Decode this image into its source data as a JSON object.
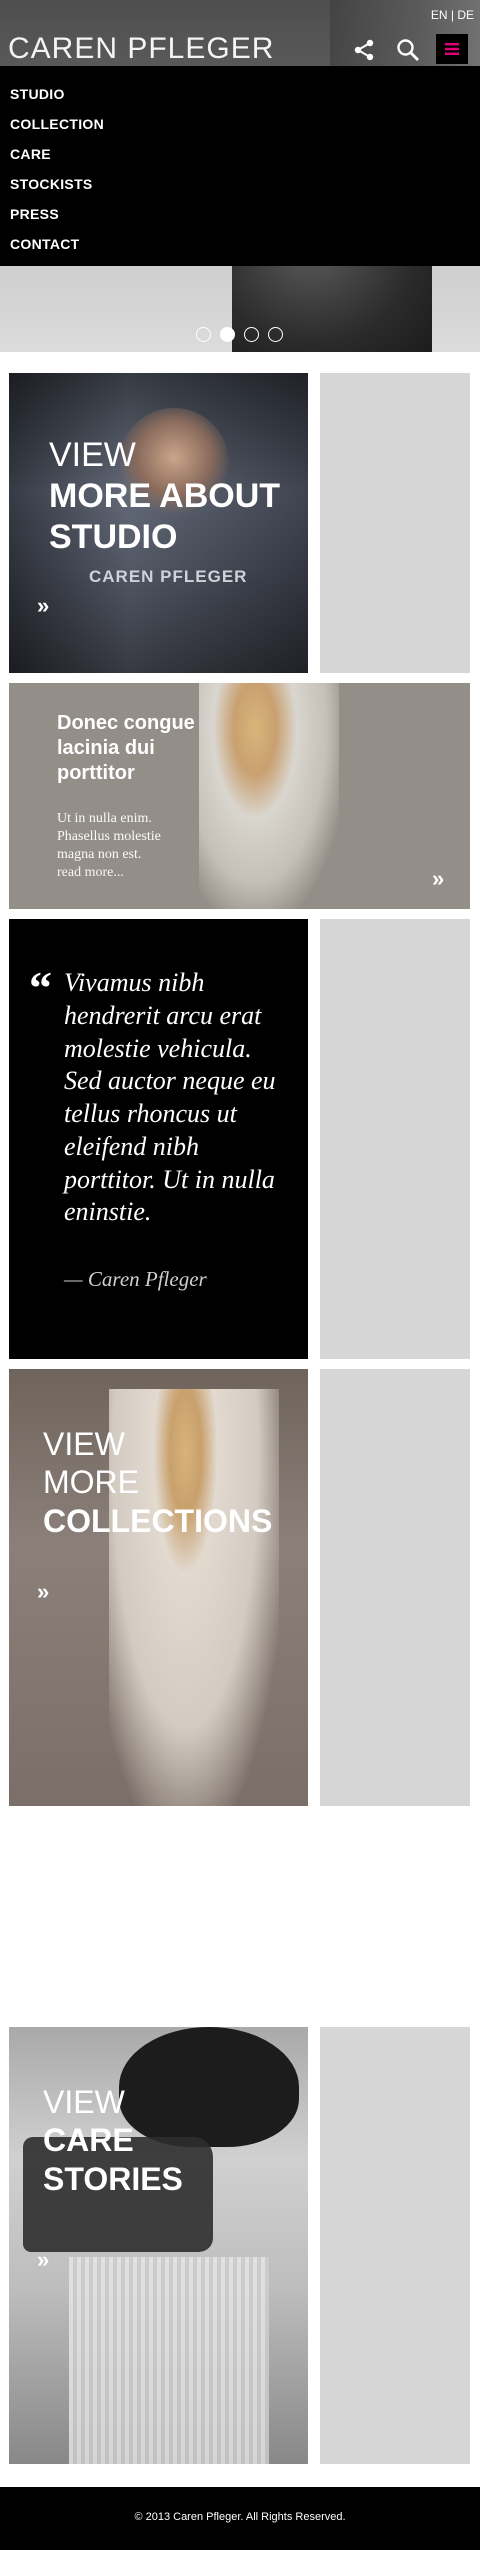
{
  "header": {
    "brand": "CAREN PFLEGER",
    "lang_en": "EN",
    "lang_sep": "|",
    "lang_de": "DE",
    "icons": [
      "share-icon",
      "search-icon",
      "hamburger-icon"
    ],
    "accent_color": "#e2007a"
  },
  "menu": {
    "items": [
      {
        "label": "STUDIO"
      },
      {
        "label": "COLLECTION"
      },
      {
        "label": "CARE"
      },
      {
        "label": "STOCKISTS"
      },
      {
        "label": "PRESS"
      },
      {
        "label": "CONTACT"
      }
    ]
  },
  "slider": {
    "total": 4,
    "active": 2
  },
  "tiles": {
    "studio": {
      "line1": "VIEW",
      "line2": "MORE ABOUT",
      "line3": "STUDIO",
      "sign": "CAREN PFLEGER",
      "chevron": "»"
    },
    "feature": {
      "title": "Donec congue lacinia dui porttitor",
      "body": "Ut in nulla enim. Phasellus molestie magna non est.",
      "more": "read more...",
      "chevron": "»"
    },
    "quote": {
      "mark": "“",
      "text": "Vivamus nibh hendrerit arcu erat molestie vehicula. Sed auctor neque eu tellus rhoncus ut eleifend nibh porttitor. Ut in nulla eninstie.",
      "author": "— Caren Pfleger"
    },
    "collections": {
      "line1": "VIEW",
      "line2": "MORE",
      "line3": "COLLECTIONS",
      "chevron": "»"
    },
    "care": {
      "line1": "VIEW",
      "line2": "CARE",
      "line3": "STORIES",
      "chevron": "»"
    }
  },
  "footer": {
    "copyright": "© 2013 Caren Pfleger. All Rights Reserved."
  }
}
